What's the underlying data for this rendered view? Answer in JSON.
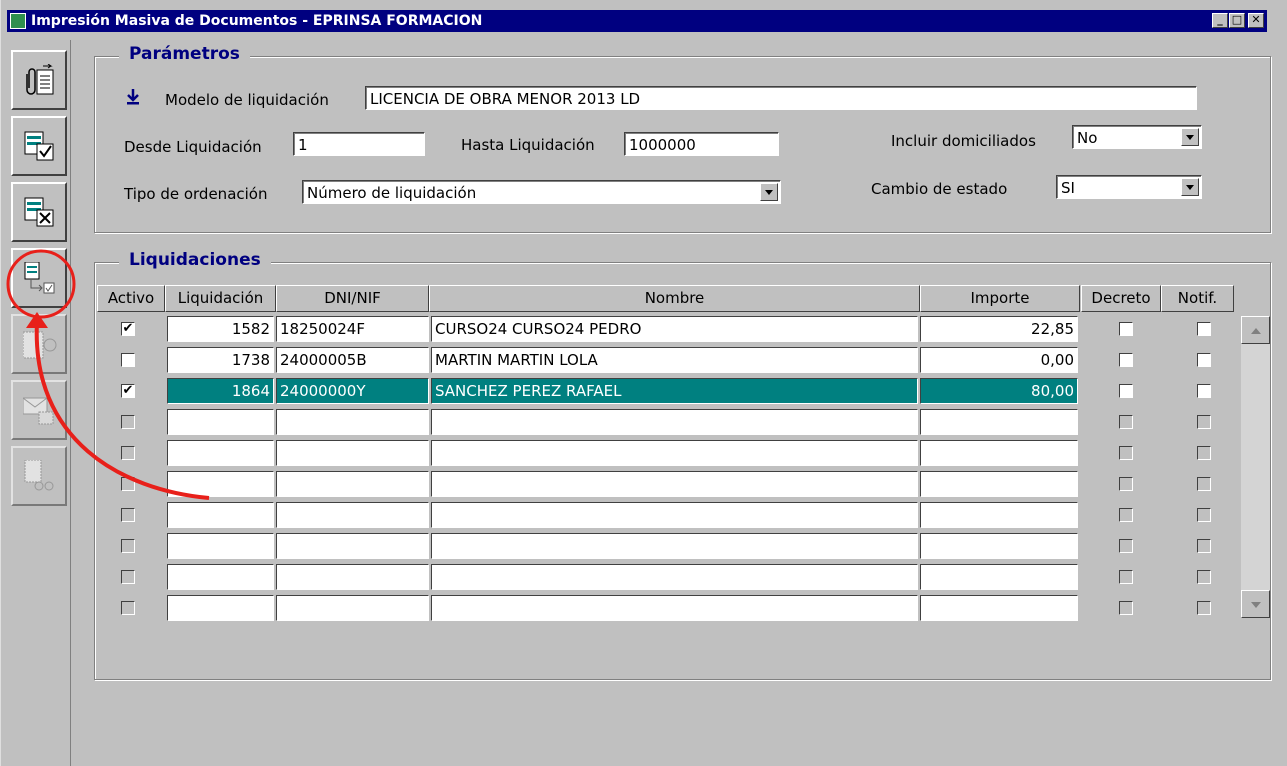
{
  "window": {
    "title": "Impresión Masiva de Documentos - EPRINSA FORMACION",
    "minimize": "_",
    "maximize": "□",
    "close": "✕"
  },
  "toolbar": {
    "buttons": [
      {
        "name": "attach-document-button",
        "icon": "clip-document-icon",
        "enabled": true
      },
      {
        "name": "select-all-button",
        "icon": "document-check-icon",
        "enabled": true
      },
      {
        "name": "deselect-all-button",
        "icon": "document-cross-icon",
        "enabled": true
      },
      {
        "name": "change-state-button",
        "icon": "document-state-change-icon",
        "enabled": true
      },
      {
        "name": "print-button",
        "icon": "print-icon",
        "enabled": false
      },
      {
        "name": "mail-button",
        "icon": "envelope-icon",
        "enabled": false
      },
      {
        "name": "notify-button",
        "icon": "document-glasses-icon",
        "enabled": false
      }
    ]
  },
  "parametros": {
    "title": "Parámetros",
    "modelo_label": "Modelo de liquidación",
    "modelo_value": "LICENCIA DE OBRA MENOR 2013 LD",
    "desde_label": "Desde Liquidación",
    "desde_value": "1",
    "hasta_label": "Hasta Liquidación",
    "hasta_value": "1000000",
    "incluir_label": "Incluir domiciliados",
    "incluir_value": "No",
    "tipo_label": "Tipo de ordenación",
    "tipo_value": "Número de liquidación",
    "cambio_label": "Cambio de estado",
    "cambio_value": "SI"
  },
  "liquidaciones": {
    "title": "Liquidaciones",
    "columns": [
      "Activo",
      "Liquidación",
      "DNI/NIF",
      "Nombre",
      "Importe",
      "Decreto",
      "Notif."
    ],
    "rows": [
      {
        "activo": true,
        "liquidacion": "1582",
        "dni": "18250024F",
        "nombre": "CURSO24 CURSO24 PEDRO",
        "importe": "22,85",
        "decreto": false,
        "notif": false,
        "selected": false,
        "filled": true
      },
      {
        "activo": false,
        "liquidacion": "1738",
        "dni": "24000005B",
        "nombre": "MARTIN MARTIN LOLA",
        "importe": "0,00",
        "decreto": false,
        "notif": false,
        "selected": false,
        "filled": true
      },
      {
        "activo": true,
        "liquidacion": "1864",
        "dni": "24000000Y",
        "nombre": "SANCHEZ PEREZ RAFAEL",
        "importe": "80,00",
        "decreto": false,
        "notif": false,
        "selected": true,
        "filled": true
      },
      {
        "activo": false,
        "liquidacion": "",
        "dni": "",
        "nombre": "",
        "importe": "",
        "decreto": false,
        "notif": false,
        "selected": false,
        "filled": false
      },
      {
        "activo": false,
        "liquidacion": "",
        "dni": "",
        "nombre": "",
        "importe": "",
        "decreto": false,
        "notif": false,
        "selected": false,
        "filled": false
      },
      {
        "activo": false,
        "liquidacion": "",
        "dni": "",
        "nombre": "",
        "importe": "",
        "decreto": false,
        "notif": false,
        "selected": false,
        "filled": false
      },
      {
        "activo": false,
        "liquidacion": "",
        "dni": "",
        "nombre": "",
        "importe": "",
        "decreto": false,
        "notif": false,
        "selected": false,
        "filled": false
      },
      {
        "activo": false,
        "liquidacion": "",
        "dni": "",
        "nombre": "",
        "importe": "",
        "decreto": false,
        "notif": false,
        "selected": false,
        "filled": false
      },
      {
        "activo": false,
        "liquidacion": "",
        "dni": "",
        "nombre": "",
        "importe": "",
        "decreto": false,
        "notif": false,
        "selected": false,
        "filled": false
      },
      {
        "activo": false,
        "liquidacion": "",
        "dni": "",
        "nombre": "",
        "importe": "",
        "decreto": false,
        "notif": false,
        "selected": false,
        "filled": false
      }
    ]
  },
  "colors": {
    "titlebar": "#000080",
    "group_title": "#000080",
    "selected_row": "#008080",
    "annotation": "#e8201a"
  }
}
